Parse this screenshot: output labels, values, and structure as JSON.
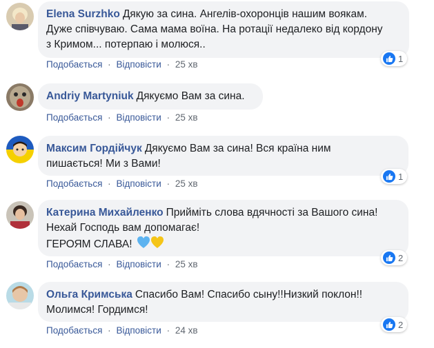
{
  "ui": {
    "like_label": "Подобається",
    "reply_label": "Відповісти",
    "separator": "·"
  },
  "colors": {
    "author": "#385898",
    "bubble": "#f2f3f5",
    "like_blue": "#1877f2",
    "meta": "#606770"
  },
  "comments": [
    {
      "author": "Elena Surzhko",
      "line1": "Дякую за сина. Ангелів-охоронців нашим воякам.",
      "line2": "Дуже співчуваю. Сама мама воїна. На ротації недалеко від кордону",
      "line3": "з Кримом... потерпаю і молюся..",
      "time": "25 хв",
      "reactions": "1",
      "reaction_icon": "like-icon"
    },
    {
      "author": "Andriy Martyniuk",
      "line1": "Дякуємо Вам за сина.",
      "time": "25 хв",
      "reactions": ""
    },
    {
      "author": "Максим Гордійчук",
      "line1": "Дякуємо Вам за сина! Вся країна ним",
      "line2": "пишається! Ми з Вами!",
      "time": "25 хв",
      "reactions": "1",
      "reaction_icon": "like-icon"
    },
    {
      "author": "Катерина Михайленко",
      "line1": "Прийміть слова вдячності за Вашого сина!",
      "line2": "Нехай Господь вам допомагає!",
      "line3": "ГЕРОЯМ СЛАВА!",
      "line3_emoji": "blue-heart-icon yellow-heart-icon",
      "time": "25 хв",
      "reactions": "2",
      "reaction_icon": "like-icon"
    },
    {
      "author": "Ольга Кримська",
      "line1": "Спасибо Вам! Спасибо сыну!!Низкий поклон!!",
      "line2": "Молимся! Гордимся!",
      "time": "24 хв",
      "reactions": "2",
      "reaction_icon": "like-icon"
    }
  ]
}
